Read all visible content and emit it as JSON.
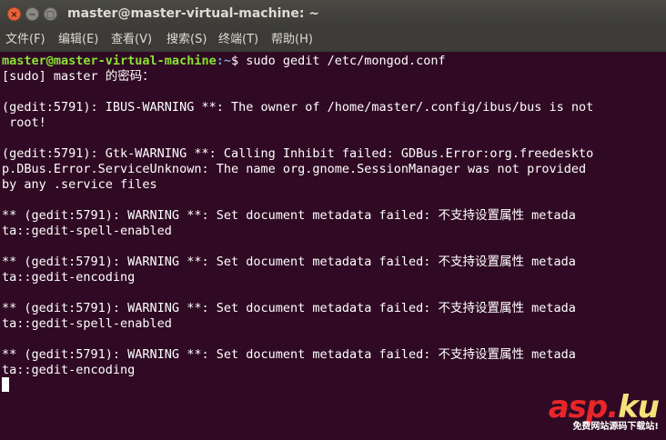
{
  "window": {
    "title": "master@master-virtual-machine: ~",
    "close_glyph": "×",
    "minimize_glyph": "−",
    "maximize_glyph": "□"
  },
  "menubar": {
    "items": [
      {
        "label": "文件(F)"
      },
      {
        "label": "编辑(E)"
      },
      {
        "label": "查看(V)"
      },
      {
        "label": "搜索(S)"
      },
      {
        "label": "终端(T)"
      },
      {
        "label": "帮助(H)"
      }
    ]
  },
  "terminal": {
    "prompt": {
      "user_host": "master@master-virtual-machine",
      "path": ":~",
      "symbol": "$ ",
      "command": "sudo gedit /etc/mongod.conf"
    },
    "lines": [
      "[sudo] master 的密码：",
      "",
      "(gedit:5791): IBUS-WARNING **: The owner of /home/master/.config/ibus/bus is not",
      " root!",
      "",
      "(gedit:5791): Gtk-WARNING **: Calling Inhibit failed: GDBus.Error:org.freedeskto",
      "p.DBus.Error.ServiceUnknown: The name org.gnome.SessionManager was not provided",
      "by any .service files",
      "",
      "** (gedit:5791): WARNING **: Set document metadata failed: 不支持设置属性 metada",
      "ta::gedit-spell-enabled",
      "",
      "** (gedit:5791): WARNING **: Set document metadata failed: 不支持设置属性 metada",
      "ta::gedit-encoding",
      "",
      "** (gedit:5791): WARNING **: Set document metadata failed: 不支持设置属性 metada",
      "ta::gedit-spell-enabled",
      "",
      "** (gedit:5791): WARNING **: Set document metadata failed: 不支持设置属性 metada",
      "ta::gedit-encoding"
    ]
  },
  "watermark": {
    "asp": "asp",
    "dot": ".",
    "ku": "ku",
    "tagline": "免费网站源码下载站!"
  },
  "colors": {
    "terminal_bg": "#300a24",
    "prompt_user": "#8ae234",
    "prompt_path": "#729fcf",
    "titlebar_bg": "#3c3b37",
    "close_button": "#e7643a"
  }
}
